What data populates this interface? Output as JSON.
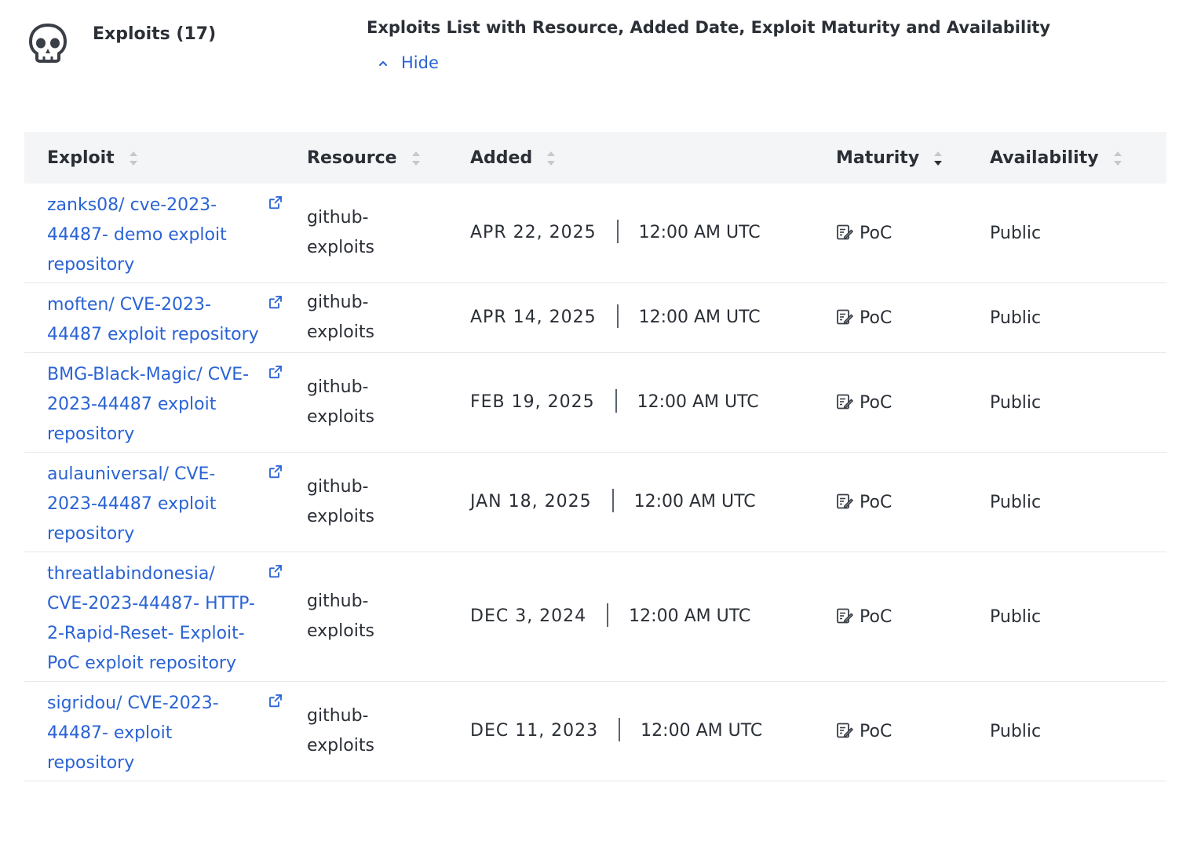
{
  "header": {
    "section_title": "Exploits (17)",
    "description": "Exploits List with Resource, Added Date, Exploit Maturity and Availability",
    "toggle_label": "Hide",
    "icons": {
      "section": "skull-icon",
      "toggle": "chevron-up-icon"
    }
  },
  "table": {
    "columns": [
      "Exploit",
      "Resource",
      "Added",
      "Maturity",
      "Availability"
    ],
    "rows": [
      {
        "exploit": "zanks08/ cve-2023-44487- demo exploit repository",
        "resource": "github- exploits",
        "date": "APR 22, 2025",
        "time": "12:00 AM UTC",
        "maturity": "PoC",
        "availability": "Public"
      },
      {
        "exploit": "moften/ CVE-2023-44487 exploit repository",
        "resource": "github- exploits",
        "date": "APR 14, 2025",
        "time": "12:00 AM UTC",
        "maturity": "PoC",
        "availability": "Public"
      },
      {
        "exploit": "BMG-Black-Magic/ CVE-2023-44487 exploit repository",
        "resource": "github- exploits",
        "date": "FEB 19, 2025",
        "time": "12:00 AM UTC",
        "maturity": "PoC",
        "availability": "Public"
      },
      {
        "exploit": "aulauniversal/ CVE-2023-44487 exploit repository",
        "resource": "github- exploits",
        "date": "JAN 18, 2025",
        "time": "12:00 AM UTC",
        "maturity": "PoC",
        "availability": "Public"
      },
      {
        "exploit": "threatlabindonesia/ CVE-2023-44487- HTTP-2-Rapid-Reset- Exploit-PoC exploit repository",
        "resource": "github- exploits",
        "date": "DEC 3, 2024",
        "time": "12:00 AM UTC",
        "maturity": "PoC",
        "availability": "Public"
      },
      {
        "exploit": "sigridou/ CVE-2023-44487- exploit repository",
        "resource": "github- exploits",
        "date": "DEC 11, 2023",
        "time": "12:00 AM UTC",
        "maturity": "PoC",
        "availability": "Public"
      }
    ]
  },
  "colors": {
    "link": "#2a63d4",
    "header_bg": "#f4f5f7",
    "text": "#2b2f36"
  }
}
